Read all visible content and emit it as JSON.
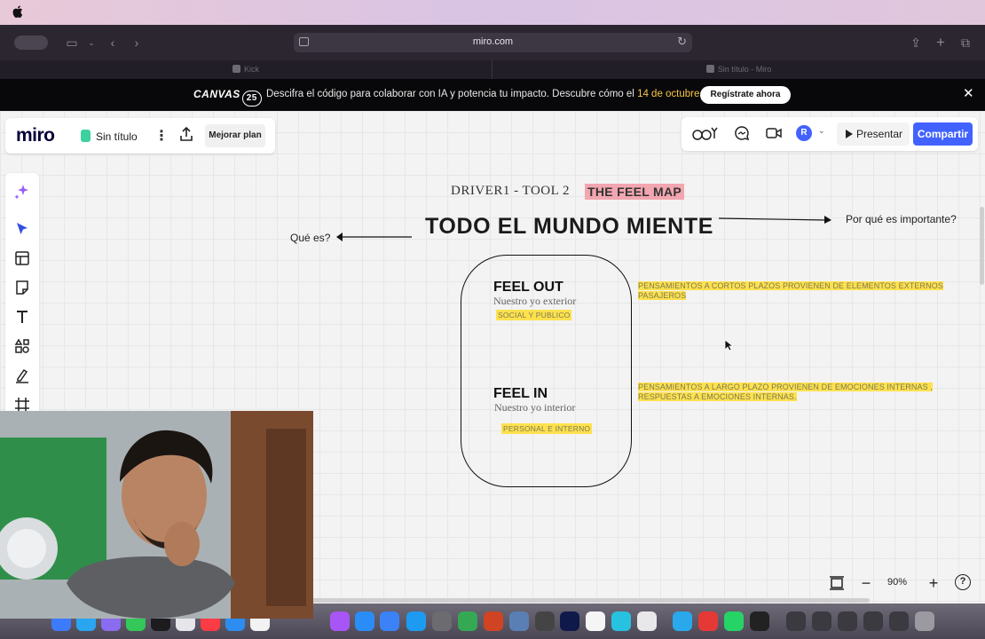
{
  "browser": {
    "url": "miro.com",
    "tabs": [
      {
        "label": "Kick"
      },
      {
        "label": "Sin título - Miro"
      }
    ]
  },
  "banner": {
    "logo_text": "CANVAS",
    "logo_num": "25",
    "text_before": "Descifra el código para colaborar con IA y potencia tu impacto. Descubre cómo el ",
    "date_highlight": "14 de octubre",
    "text_after": ".",
    "cta_label": "Regístrate ahora",
    "colors": {
      "highlight": "#f5c542"
    }
  },
  "miro": {
    "logo": "miro",
    "board_name": "Sin título",
    "upgrade_label": "Mejorar plan",
    "avatar_initial": "R",
    "present_label": "Presentar",
    "share_label": "Compartir",
    "accent_color": "#4262ff",
    "left_tools": [
      "ai-sparkle-icon",
      "select-cursor-icon",
      "templates-icon",
      "sticky-note-icon",
      "text-icon",
      "shapes-icon",
      "pen-icon",
      "frame-icon"
    ],
    "zoom": "90%"
  },
  "board": {
    "frame_title": "DRIVER1 - TOOL 2",
    "feel_map_label": "THE FEEL MAP",
    "main_title": "TODO EL MUNDO MIENTE",
    "left_label": "Qué es?",
    "right_label": "Por qué es importante?",
    "feel_out": {
      "title": "FEEL OUT",
      "subtitle": "Nuestro yo exterior",
      "tag": "SOCIAL Y PUBLICO"
    },
    "feel_in": {
      "title": "FEEL IN",
      "subtitle": "Nuestro yo interior",
      "tag": "PERSONAL E INTERNO"
    },
    "note_short_term": "PENSAMIENTOS A CORTOS PLAZOS PROVIENEN DE ELEMENTOS EXTERNOS PASAJEROS",
    "note_long_term": "PENSAMIENTOS A LARGO PLAZO PROVIENEN DE EMOCIONES INTERNAS , RESPUESTAS A EMOCIONES INTERNAS.",
    "highlight_colors": {
      "yellow": "#ffe14d",
      "pink": "#f2a6b0"
    }
  }
}
